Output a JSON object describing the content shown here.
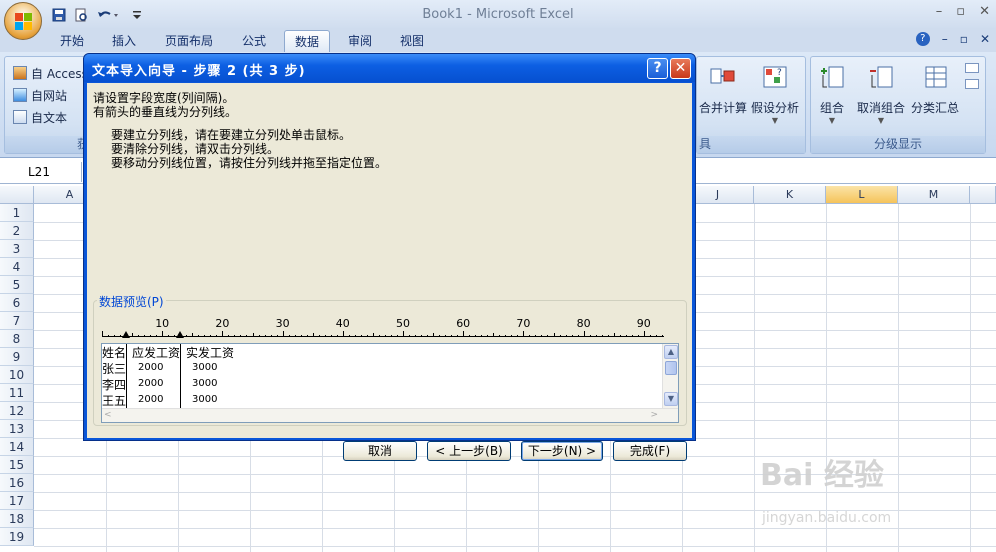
{
  "window": {
    "title": "Book1 - Microsoft Excel"
  },
  "qat": {
    "save_icon": "save-icon",
    "print_icon": "print-preview-icon",
    "undo_icon": "undo-icon",
    "customize_icon": "customize-icon"
  },
  "window_controls": {
    "minimize": "–",
    "maximize": "▫",
    "close": "✕"
  },
  "tabs": [
    "开始",
    "插入",
    "页面布局",
    "公式",
    "数据",
    "审阅",
    "视图"
  ],
  "active_tab": "数据",
  "help_controls": {
    "help": "?",
    "minimize": "–",
    "restore": "▫",
    "close": "✕"
  },
  "ribbon": {
    "get_external": {
      "items": [
        "自 Access",
        "自网站",
        "自文本"
      ],
      "label": "获"
    },
    "data_tools": {
      "consolidate": "合并计算",
      "what_if": "假设分析",
      "label": "具"
    },
    "outline": {
      "group": "组合",
      "ungroup": "取消组合",
      "subtotal": "分类汇总",
      "label": "分级显示"
    }
  },
  "name_box": {
    "value": "L21"
  },
  "columns": [
    "A",
    "J",
    "K",
    "L",
    "M"
  ],
  "selected_column": "L",
  "rows": [
    "1",
    "2",
    "3",
    "4",
    "5",
    "6",
    "7",
    "8",
    "9",
    "10",
    "11",
    "12",
    "13",
    "14",
    "15",
    "16",
    "17",
    "18",
    "19"
  ],
  "dialog": {
    "title": "文本导入向导 - 步骤 2 (共 3 步)",
    "help_btn": "?",
    "close_btn": "✕",
    "line1": "请设置字段宽度(列间隔)。",
    "line2": "有箭头的垂直线为分列线。",
    "inst1": "要建立分列线，请在要建立分列处单击鼠标。",
    "inst2": "要清除分列线，请双击分列线。",
    "inst3": "要移动分列线位置，请按住分列线并拖至指定位置。",
    "preview_label": "数据预览(P)",
    "ruler": [
      "10",
      "20",
      "30",
      "40",
      "50",
      "60",
      "70",
      "80",
      "90"
    ],
    "preview_rows": [
      [
        "姓名",
        "应发工资",
        "实发工资"
      ],
      [
        "张三",
        "2000",
        "3000"
      ],
      [
        "李四",
        "2000",
        "3000"
      ],
      [
        "王五",
        "2000",
        "3000"
      ]
    ],
    "buttons": {
      "cancel": "取消",
      "back": "< 上一步(B)",
      "next": "下一步(N) >",
      "finish": "完成(F)"
    }
  },
  "watermark": {
    "brand": "Bai 经验",
    "url": "jingyan.baidu.com"
  }
}
